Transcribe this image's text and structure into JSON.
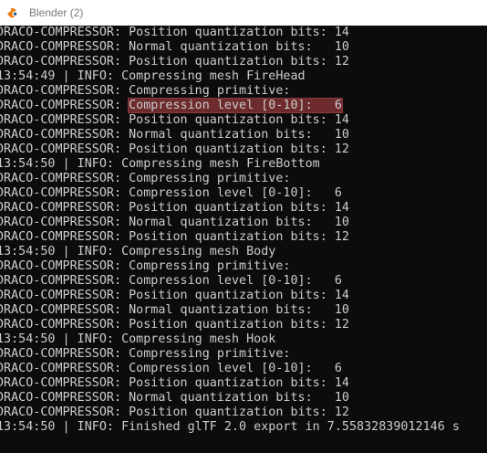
{
  "window": {
    "title": "Blender (2)",
    "app_icon": "blender-icon"
  },
  "console": {
    "lines": [
      {
        "prefix": "DRACO-COMPRESSOR: ",
        "text": "Position quantization bits: 14"
      },
      {
        "prefix": "DRACO-COMPRESSOR: ",
        "text": "Normal quantization bits:   10"
      },
      {
        "prefix": "DRACO-COMPRESSOR: ",
        "text": "Position quantization bits: 12"
      },
      {
        "prefix": "13:54:49 | INFO: ",
        "text": "Compressing mesh FireHead"
      },
      {
        "prefix": "DRACO-COMPRESSOR: ",
        "text": "Compressing primitive:"
      },
      {
        "prefix": "DRACO-COMPRESSOR: ",
        "text": "Compression level [0-10]:   6",
        "selected": true
      },
      {
        "prefix": "DRACO-COMPRESSOR: ",
        "text": "Position quantization bits: 14"
      },
      {
        "prefix": "DRACO-COMPRESSOR: ",
        "text": "Normal quantization bits:   10"
      },
      {
        "prefix": "DRACO-COMPRESSOR: ",
        "text": "Position quantization bits: 12"
      },
      {
        "prefix": "13:54:50 | INFO: ",
        "text": "Compressing mesh FireBottom"
      },
      {
        "prefix": "DRACO-COMPRESSOR: ",
        "text": "Compressing primitive:"
      },
      {
        "prefix": "DRACO-COMPRESSOR: ",
        "text": "Compression level [0-10]:   6"
      },
      {
        "prefix": "DRACO-COMPRESSOR: ",
        "text": "Position quantization bits: 14"
      },
      {
        "prefix": "DRACO-COMPRESSOR: ",
        "text": "Normal quantization bits:   10"
      },
      {
        "prefix": "DRACO-COMPRESSOR: ",
        "text": "Position quantization bits: 12"
      },
      {
        "prefix": "13:54:50 | INFO: ",
        "text": "Compressing mesh Body"
      },
      {
        "prefix": "DRACO-COMPRESSOR: ",
        "text": "Compressing primitive:"
      },
      {
        "prefix": "DRACO-COMPRESSOR: ",
        "text": "Compression level [0-10]:   6"
      },
      {
        "prefix": "DRACO-COMPRESSOR: ",
        "text": "Position quantization bits: 14"
      },
      {
        "prefix": "DRACO-COMPRESSOR: ",
        "text": "Normal quantization bits:   10"
      },
      {
        "prefix": "DRACO-COMPRESSOR: ",
        "text": "Position quantization bits: 12"
      },
      {
        "prefix": "13:54:50 | INFO: ",
        "text": "Compressing mesh Hook"
      },
      {
        "prefix": "DRACO-COMPRESSOR: ",
        "text": "Compressing primitive:"
      },
      {
        "prefix": "DRACO-COMPRESSOR: ",
        "text": "Compression level [0-10]:   6"
      },
      {
        "prefix": "DRACO-COMPRESSOR: ",
        "text": "Position quantization bits: 14"
      },
      {
        "prefix": "DRACO-COMPRESSOR: ",
        "text": "Normal quantization bits:   10"
      },
      {
        "prefix": "DRACO-COMPRESSOR: ",
        "text": "Position quantization bits: 12"
      },
      {
        "prefix": "13:54:50 | INFO: ",
        "text": "Finished glTF 2.0 export in 7.55832839012146 s"
      }
    ]
  },
  "colors": {
    "console_background": "#0c0c0c",
    "console_text": "#cccccc",
    "selection": "#6e2b2e",
    "titlebar_background": "#ffffff",
    "title_text": "#7a7a7a"
  }
}
